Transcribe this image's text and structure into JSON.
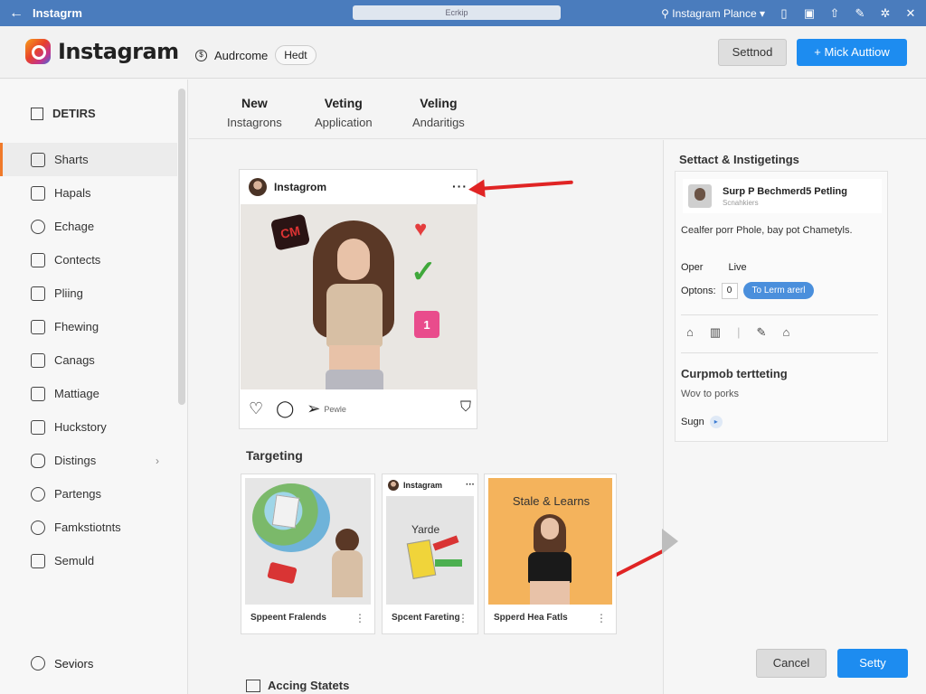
{
  "titlebar": {
    "app_name": "Instagrm",
    "search_text": "Ecrkip",
    "account": "Instagram Plance"
  },
  "header": {
    "brand": "Instagram",
    "audience_label": "Audrcome",
    "audience_pill": "Hedt",
    "secondary_button": "Settnod",
    "primary_button": "+ Mick Auttiow"
  },
  "sidebar": {
    "heading": "DETIRS",
    "items": [
      {
        "label": "Sharts",
        "icon": "home-icon"
      },
      {
        "label": "Hapals",
        "icon": "tag-icon"
      },
      {
        "label": "Echage",
        "icon": "search-icon"
      },
      {
        "label": "Contects",
        "icon": "copy-icon"
      },
      {
        "label": "Pliing",
        "icon": "image-icon"
      },
      {
        "label": "Fhewing",
        "icon": "chat-icon"
      },
      {
        "label": "Canags",
        "icon": "cards-icon"
      },
      {
        "label": "Mattiage",
        "icon": "tag-icon"
      },
      {
        "label": "Huckstory",
        "icon": "chart-icon"
      },
      {
        "label": "Distings",
        "icon": "lock-icon"
      },
      {
        "label": "Partengs",
        "icon": "search-icon"
      },
      {
        "label": "Famkstiotnts",
        "icon": "clock-icon"
      },
      {
        "label": "Semuld",
        "icon": "list-icon"
      }
    ],
    "bottom_item": "Seviors"
  },
  "tabs": [
    {
      "line1": "New",
      "line2": "Instagrons"
    },
    {
      "line1": "Veting",
      "line2": "Application"
    },
    {
      "line1": "Veling",
      "line2": "Andaritigs"
    }
  ],
  "post": {
    "account": "Instagrom",
    "sticker_text": "CM",
    "bag_number": "1",
    "action_caption": "Pewle"
  },
  "targeting": {
    "title": "Targeting",
    "cards": [
      {
        "caption": "Sppeent Fralends"
      },
      {
        "caption": "Spcent Fareting",
        "account": "Instagram",
        "image_text": "Yarde"
      },
      {
        "caption": "Spperd Hea Fatls",
        "image_text": "Stale & Learns"
      }
    ]
  },
  "right_panel": {
    "title": "Settact & Instigetings",
    "user_name": "Surp P Bechmerd5 Petling",
    "user_sub": "Scnahkiers",
    "description": "Cealfer porr Phole, bay pot Chametyls.",
    "row1_a": "Oper",
    "row1_b": "Live",
    "options_label": "Optons:",
    "options_value": "0",
    "options_toggle": "To Lerm arerl",
    "section_title": "Curpmob tertteting",
    "section_text": "Wov to porks",
    "sign_label": "Sugn",
    "cancel": "Cancel",
    "setup": "Setty"
  },
  "bottom": {
    "title": "Accing Statets"
  },
  "colors": {
    "titlebar": "#4a7cbd",
    "primary": "#1d8cf0",
    "arrow": "#e02424",
    "active_accent": "#f07a2a"
  }
}
